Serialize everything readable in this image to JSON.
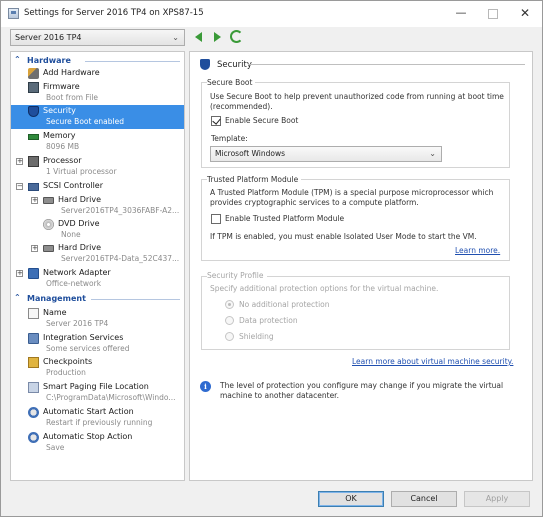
{
  "window": {
    "title": "Settings for Server 2016 TP4 on XPS87-15",
    "minimize": "—",
    "close": "✕"
  },
  "toolbar": {
    "vm_selected": "Server 2016 TP4"
  },
  "sidebar": {
    "hardware_header": "Hardware",
    "management_header": "Management",
    "hardware_items": [
      {
        "label": "Add Hardware",
        "sub": "",
        "icon": "add-hardware-icon"
      },
      {
        "label": "Firmware",
        "sub": "Boot from File",
        "icon": "firmware-icon"
      },
      {
        "label": "Security",
        "sub": "Secure Boot enabled",
        "icon": "shield-icon",
        "selected": true
      },
      {
        "label": "Memory",
        "sub": "8096 MB",
        "icon": "memory-icon"
      },
      {
        "label": "Processor",
        "sub": "1 Virtual processor",
        "icon": "processor-icon"
      },
      {
        "label": "SCSI Controller",
        "sub": "",
        "icon": "scsi-controller-icon"
      },
      {
        "label": "Hard Drive",
        "sub": "Server2016TP4_3036FABF-A2...",
        "icon": "hard-drive-icon"
      },
      {
        "label": "DVD Drive",
        "sub": "None",
        "icon": "dvd-drive-icon"
      },
      {
        "label": "Hard Drive",
        "sub": "Server2016TP4-Data_52C437...",
        "icon": "hard-drive-icon"
      },
      {
        "label": "Network Adapter",
        "sub": "Office-network",
        "icon": "network-adapter-icon"
      }
    ],
    "management_items": [
      {
        "label": "Name",
        "sub": "Server 2016 TP4",
        "icon": "name-icon"
      },
      {
        "label": "Integration Services",
        "sub": "Some services offered",
        "icon": "integration-services-icon"
      },
      {
        "label": "Checkpoints",
        "sub": "Production",
        "icon": "checkpoints-icon"
      },
      {
        "label": "Smart Paging File Location",
        "sub": "C:\\ProgramData\\Microsoft\\Windo...",
        "icon": "paging-file-icon"
      },
      {
        "label": "Automatic Start Action",
        "sub": "Restart if previously running",
        "icon": "auto-start-icon"
      },
      {
        "label": "Automatic Stop Action",
        "sub": "Save",
        "icon": "auto-stop-icon"
      }
    ]
  },
  "panel": {
    "title": "Security",
    "secure_boot": {
      "group_label": "Secure Boot",
      "description_line1": "Use Secure Boot to help prevent unauthorized code from running at boot time",
      "description_line2": "(recommended).",
      "enable_label": "Enable Secure Boot",
      "enable_checked": true,
      "template_label": "Template:",
      "template_value": "Microsoft Windows"
    },
    "tpm": {
      "group_label": "Trusted Platform Module",
      "description_line1": "A Trusted Platform Module (TPM) is a special purpose microprocessor which",
      "description_line2": "provides cryptographic services to a compute platform.",
      "enable_label": "Enable Trusted Platform Module",
      "enable_checked": false,
      "note": "If TPM is enabled, you must enable Isolated User Mode to start the VM.",
      "learn_more": "Learn more."
    },
    "security_profile": {
      "group_label": "Security Profile",
      "description": "Specify additional protection options for the virtual machine.",
      "options": [
        "No additional protection",
        "Data protection",
        "Shielding"
      ],
      "selected_index": 0
    },
    "learn_more_security": "Learn more about virtual machine security.",
    "info_line1": "The level of protection you configure may change if you migrate the virtual",
    "info_line2": "machine to another datacenter."
  },
  "buttons": {
    "ok": "OK",
    "cancel": "Cancel",
    "apply": "Apply"
  }
}
